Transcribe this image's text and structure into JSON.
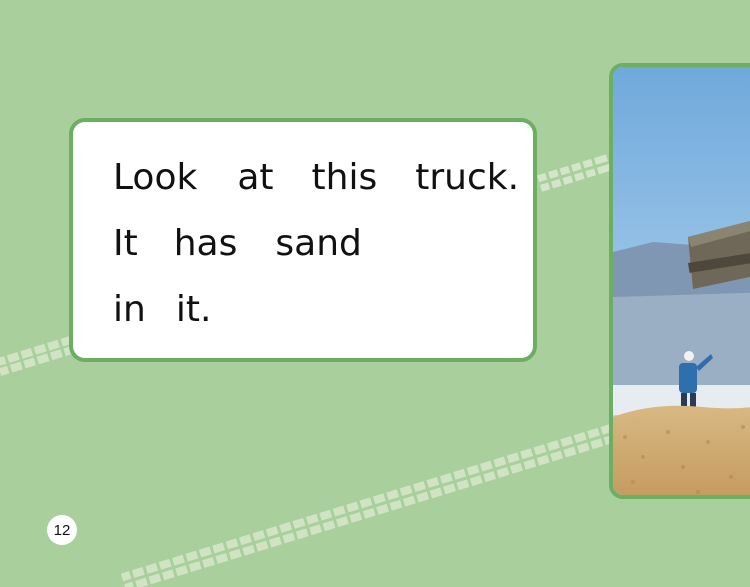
{
  "story": {
    "line1": [
      "Look",
      "at",
      "this",
      "truck."
    ],
    "line2": [
      "It",
      "has",
      "sand"
    ],
    "line3": [
      "in",
      "it."
    ]
  },
  "page_number": "12",
  "colors": {
    "background": "#a9cf9d",
    "border": "#6cae62",
    "card": "#ffffff",
    "track": "#d4e6c9"
  },
  "photo": {
    "subject": "dump-truck-with-sand"
  }
}
